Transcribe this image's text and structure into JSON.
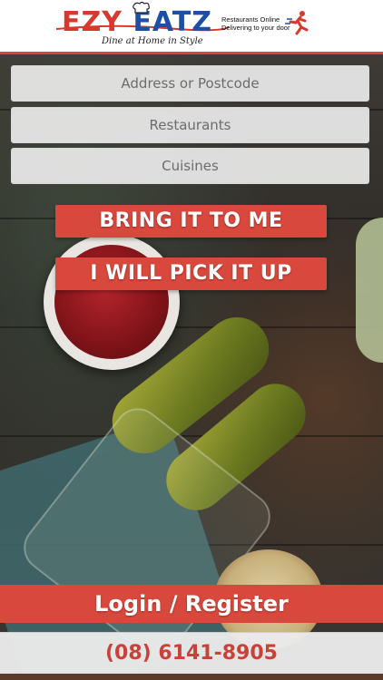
{
  "brand": {
    "logo_left": "EZY",
    "logo_right": "EATZ",
    "tagline": "Dine at Home in Style",
    "side_line1": "Restaurants Online",
    "side_line2": "Delivering to your door"
  },
  "search": {
    "address_placeholder": "Address or Postcode",
    "restaurants_placeholder": "Restaurants",
    "cuisines_placeholder": "Cuisines"
  },
  "actions": {
    "deliver_label": "BRING IT TO ME",
    "pickup_label": "I WILL PICK IT UP"
  },
  "footer": {
    "login_label": "Login / Register",
    "phone": "(08) 6141-8905"
  },
  "colors": {
    "accent": "#d9483c",
    "brand_red": "#d63a2f",
    "brand_blue": "#1e4fa6"
  },
  "icons": {
    "chef_hat": "chef-hat-icon",
    "runner": "delivery-runner-icon"
  }
}
